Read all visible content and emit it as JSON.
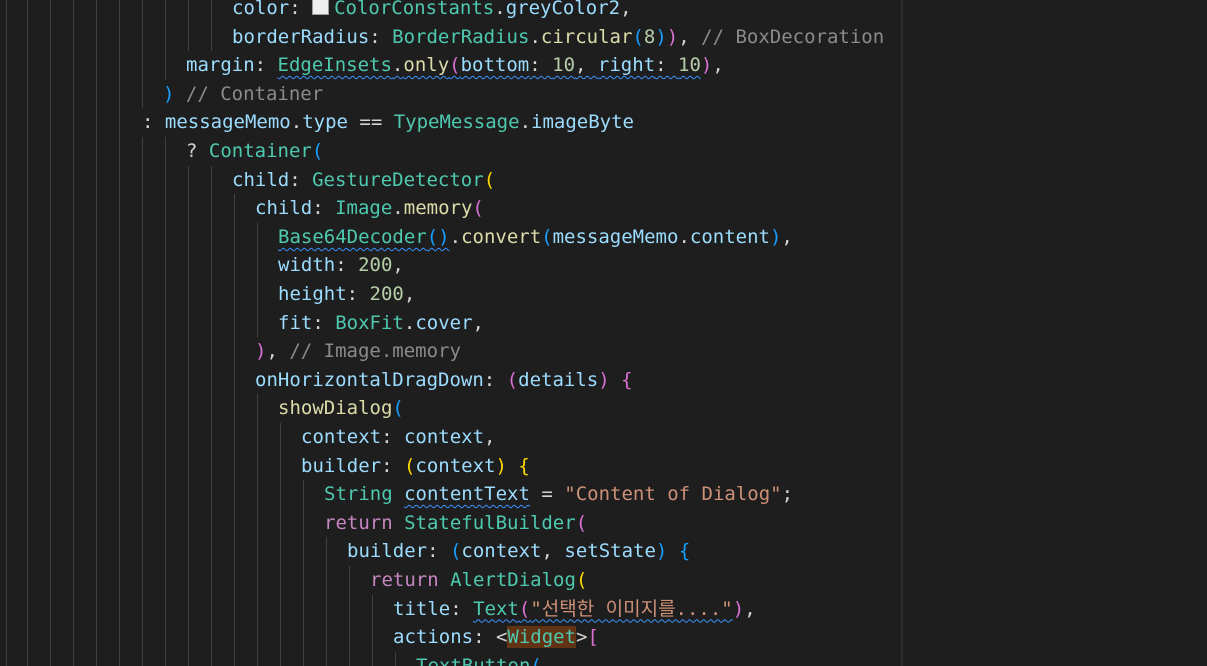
{
  "editor": {
    "language": "dart",
    "colors": {
      "background": "#1e1e1e",
      "default": "#d4d4d4",
      "property": "#9cdcfe",
      "type": "#4ec9b0",
      "method": "#dcdcaa",
      "number": "#b5cea8",
      "string": "#ce9178",
      "comment": "#6a9955",
      "commentGrey": "#8b8b8b",
      "keyword": "#c586c0",
      "bracket1": "#ffd700",
      "bracket2": "#da70d6",
      "bracket3": "#179fff"
    },
    "lines": [
      {
        "indent": 232,
        "guides": [
          6,
          27,
          50,
          73,
          96,
          119,
          142,
          165,
          188,
          211
        ],
        "tokens": [
          {
            "t": "color",
            "c": "property"
          },
          {
            "t": ": ",
            "c": "default"
          },
          {
            "t": "",
            "c": "swatch"
          },
          {
            "t": "ColorConstants",
            "c": "type"
          },
          {
            "t": ".",
            "c": "default"
          },
          {
            "t": "greyColor2",
            "c": "property"
          },
          {
            "t": ",",
            "c": "default"
          }
        ]
      },
      {
        "indent": 232,
        "guides": [
          6,
          27,
          50,
          73,
          96,
          119,
          142,
          165,
          188,
          211
        ],
        "tokens": [
          {
            "t": "borderRadius",
            "c": "property"
          },
          {
            "t": ": ",
            "c": "default"
          },
          {
            "t": "BorderRadius",
            "c": "type"
          },
          {
            "t": ".",
            "c": "default"
          },
          {
            "t": "circular",
            "c": "method"
          },
          {
            "t": "(",
            "c": "bracket3"
          },
          {
            "t": "8",
            "c": "number"
          },
          {
            "t": ")",
            "c": "bracket3"
          },
          {
            "t": ")",
            "c": "bracket2"
          },
          {
            "t": ", ",
            "c": "default"
          },
          {
            "t": "// BoxDecoration",
            "c": "commentGrey"
          }
        ]
      },
      {
        "indent": 186,
        "guides": [
          6,
          27,
          50,
          73,
          96,
          119,
          142,
          165
        ],
        "tokens": [
          {
            "t": "margin",
            "c": "property"
          },
          {
            "t": ": ",
            "c": "default"
          },
          {
            "t": "EdgeInsets",
            "c": "type",
            "sq": true
          },
          {
            "t": ".",
            "c": "default",
            "sq": true
          },
          {
            "t": "only",
            "c": "method",
            "sq": true
          },
          {
            "t": "(",
            "c": "bracket2",
            "sq": true
          },
          {
            "t": "bottom",
            "c": "property",
            "sq": true
          },
          {
            "t": ": ",
            "c": "default",
            "sq": true
          },
          {
            "t": "10",
            "c": "number",
            "sq": true
          },
          {
            "t": ", ",
            "c": "default",
            "sq": true
          },
          {
            "t": "right",
            "c": "property",
            "sq": true
          },
          {
            "t": ": ",
            "c": "default",
            "sq": true
          },
          {
            "t": "10",
            "c": "number",
            "sq": true
          },
          {
            "t": ")",
            "c": "bracket2"
          },
          {
            "t": ",",
            "c": "default"
          }
        ]
      },
      {
        "indent": 163,
        "guides": [
          6,
          27,
          50,
          73,
          96,
          119,
          142
        ],
        "tokens": [
          {
            "t": ")",
            "c": "bracket3"
          },
          {
            "t": " ",
            "c": "default"
          },
          {
            "t": "// Container",
            "c": "commentGrey"
          }
        ]
      },
      {
        "indent": 142,
        "guides": [
          6,
          27,
          50,
          73,
          96,
          119
        ],
        "tokens": [
          {
            "t": ": ",
            "c": "default"
          },
          {
            "t": "messageMemo",
            "c": "property"
          },
          {
            "t": ".",
            "c": "default"
          },
          {
            "t": "type",
            "c": "property"
          },
          {
            "t": " == ",
            "c": "default"
          },
          {
            "t": "TypeMessage",
            "c": "type"
          },
          {
            "t": ".",
            "c": "default"
          },
          {
            "t": "imageByte",
            "c": "property"
          }
        ]
      },
      {
        "indent": 186,
        "guides": [
          6,
          27,
          50,
          73,
          96,
          119,
          142,
          165
        ],
        "tokens": [
          {
            "t": "? ",
            "c": "default"
          },
          {
            "t": "Container",
            "c": "type"
          },
          {
            "t": "(",
            "c": "bracket3"
          }
        ]
      },
      {
        "indent": 232,
        "guides": [
          6,
          27,
          50,
          73,
          96,
          119,
          142,
          165,
          188,
          211
        ],
        "tokens": [
          {
            "t": "child",
            "c": "property"
          },
          {
            "t": ": ",
            "c": "default"
          },
          {
            "t": "GestureDetector",
            "c": "type"
          },
          {
            "t": "(",
            "c": "bracket1"
          }
        ]
      },
      {
        "indent": 255,
        "guides": [
          6,
          27,
          50,
          73,
          96,
          119,
          142,
          165,
          188,
          211,
          234
        ],
        "tokens": [
          {
            "t": "child",
            "c": "property"
          },
          {
            "t": ": ",
            "c": "default"
          },
          {
            "t": "Image",
            "c": "type"
          },
          {
            "t": ".",
            "c": "default"
          },
          {
            "t": "memory",
            "c": "method"
          },
          {
            "t": "(",
            "c": "bracket2"
          }
        ]
      },
      {
        "indent": 278,
        "guides": [
          6,
          27,
          50,
          73,
          96,
          119,
          142,
          165,
          188,
          211,
          234,
          257
        ],
        "tokens": [
          {
            "t": "Base64Decoder",
            "c": "type",
            "sq": true
          },
          {
            "t": "()",
            "c": "bracket3",
            "sq": true
          },
          {
            "t": ".",
            "c": "default"
          },
          {
            "t": "convert",
            "c": "method"
          },
          {
            "t": "(",
            "c": "bracket3"
          },
          {
            "t": "messageMemo",
            "c": "property"
          },
          {
            "t": ".",
            "c": "default"
          },
          {
            "t": "content",
            "c": "property"
          },
          {
            "t": ")",
            "c": "bracket3"
          },
          {
            "t": ",",
            "c": "default"
          }
        ]
      },
      {
        "indent": 278,
        "guides": [
          6,
          27,
          50,
          73,
          96,
          119,
          142,
          165,
          188,
          211,
          234,
          257
        ],
        "tokens": [
          {
            "t": "width",
            "c": "property"
          },
          {
            "t": ": ",
            "c": "default"
          },
          {
            "t": "200",
            "c": "number"
          },
          {
            "t": ",",
            "c": "default"
          }
        ]
      },
      {
        "indent": 278,
        "guides": [
          6,
          27,
          50,
          73,
          96,
          119,
          142,
          165,
          188,
          211,
          234,
          257
        ],
        "tokens": [
          {
            "t": "height",
            "c": "property"
          },
          {
            "t": ": ",
            "c": "default"
          },
          {
            "t": "200",
            "c": "number"
          },
          {
            "t": ",",
            "c": "default"
          }
        ]
      },
      {
        "indent": 278,
        "guides": [
          6,
          27,
          50,
          73,
          96,
          119,
          142,
          165,
          188,
          211,
          234,
          257
        ],
        "tokens": [
          {
            "t": "fit",
            "c": "property"
          },
          {
            "t": ": ",
            "c": "default"
          },
          {
            "t": "BoxFit",
            "c": "type"
          },
          {
            "t": ".",
            "c": "default"
          },
          {
            "t": "cover",
            "c": "property"
          },
          {
            "t": ",",
            "c": "default"
          }
        ]
      },
      {
        "indent": 255,
        "guides": [
          6,
          27,
          50,
          73,
          96,
          119,
          142,
          165,
          188,
          211,
          234
        ],
        "tokens": [
          {
            "t": ")",
            "c": "bracket2"
          },
          {
            "t": ", ",
            "c": "default"
          },
          {
            "t": "// Image.memory",
            "c": "commentGrey"
          }
        ]
      },
      {
        "indent": 255,
        "guides": [
          6,
          27,
          50,
          73,
          96,
          119,
          142,
          165,
          188,
          211,
          234
        ],
        "tokens": [
          {
            "t": "onHorizontalDragDown",
            "c": "property"
          },
          {
            "t": ": ",
            "c": "default"
          },
          {
            "t": "(",
            "c": "bracket2"
          },
          {
            "t": "details",
            "c": "property"
          },
          {
            "t": ")",
            "c": "bracket2"
          },
          {
            "t": " ",
            "c": "default"
          },
          {
            "t": "{",
            "c": "bracket2"
          }
        ]
      },
      {
        "indent": 278,
        "guides": [
          6,
          27,
          50,
          73,
          96,
          119,
          142,
          165,
          188,
          211,
          234,
          257
        ],
        "tokens": [
          {
            "t": "showDialog",
            "c": "method"
          },
          {
            "t": "(",
            "c": "bracket3"
          }
        ]
      },
      {
        "indent": 301,
        "guides": [
          6,
          27,
          50,
          73,
          96,
          119,
          142,
          165,
          188,
          211,
          234,
          257,
          280
        ],
        "tokens": [
          {
            "t": "context",
            "c": "property"
          },
          {
            "t": ": ",
            "c": "default"
          },
          {
            "t": "context",
            "c": "property"
          },
          {
            "t": ",",
            "c": "default"
          }
        ]
      },
      {
        "indent": 301,
        "guides": [
          6,
          27,
          50,
          73,
          96,
          119,
          142,
          165,
          188,
          211,
          234,
          257,
          280
        ],
        "tokens": [
          {
            "t": "builder",
            "c": "property"
          },
          {
            "t": ": ",
            "c": "default"
          },
          {
            "t": "(",
            "c": "bracket1"
          },
          {
            "t": "context",
            "c": "property"
          },
          {
            "t": ")",
            "c": "bracket1"
          },
          {
            "t": " ",
            "c": "default"
          },
          {
            "t": "{",
            "c": "bracket1"
          }
        ]
      },
      {
        "indent": 324,
        "guides": [
          6,
          27,
          50,
          73,
          96,
          119,
          142,
          165,
          188,
          211,
          234,
          257,
          280,
          303
        ],
        "tokens": [
          {
            "t": "String",
            "c": "type"
          },
          {
            "t": " ",
            "c": "default"
          },
          {
            "t": "contentText",
            "c": "property",
            "sq": true
          },
          {
            "t": " = ",
            "c": "default"
          },
          {
            "t": "\"Content of Dialog\"",
            "c": "string"
          },
          {
            "t": ";",
            "c": "default"
          }
        ]
      },
      {
        "indent": 324,
        "guides": [
          6,
          27,
          50,
          73,
          96,
          119,
          142,
          165,
          188,
          211,
          234,
          257,
          280,
          303
        ],
        "tokens": [
          {
            "t": "return",
            "c": "keyword"
          },
          {
            "t": " ",
            "c": "default"
          },
          {
            "t": "StatefulBuilder",
            "c": "type"
          },
          {
            "t": "(",
            "c": "bracket2"
          }
        ]
      },
      {
        "indent": 347,
        "guides": [
          6,
          27,
          50,
          73,
          96,
          119,
          142,
          165,
          188,
          211,
          234,
          257,
          280,
          303,
          326
        ],
        "tokens": [
          {
            "t": "builder",
            "c": "property"
          },
          {
            "t": ": ",
            "c": "default"
          },
          {
            "t": "(",
            "c": "bracket3"
          },
          {
            "t": "context",
            "c": "property"
          },
          {
            "t": ", ",
            "c": "default"
          },
          {
            "t": "setState",
            "c": "property"
          },
          {
            "t": ")",
            "c": "bracket3"
          },
          {
            "t": " ",
            "c": "default"
          },
          {
            "t": "{",
            "c": "bracket3"
          }
        ]
      },
      {
        "indent": 370,
        "guides": [
          6,
          27,
          50,
          73,
          96,
          119,
          142,
          165,
          188,
          211,
          234,
          257,
          280,
          303,
          326,
          349
        ],
        "tokens": [
          {
            "t": "return",
            "c": "keyword"
          },
          {
            "t": " ",
            "c": "default"
          },
          {
            "t": "AlertDialog",
            "c": "type"
          },
          {
            "t": "(",
            "c": "bracket1"
          }
        ]
      },
      {
        "indent": 393,
        "guides": [
          6,
          27,
          50,
          73,
          96,
          119,
          142,
          165,
          188,
          211,
          234,
          257,
          280,
          303,
          326,
          349,
          372
        ],
        "tokens": [
          {
            "t": "title",
            "c": "property"
          },
          {
            "t": ": ",
            "c": "default"
          },
          {
            "t": "Text",
            "c": "type",
            "sq": true
          },
          {
            "t": "(",
            "c": "bracket2",
            "sq": true
          },
          {
            "t": "\"선택한 이미지를....\"",
            "c": "string",
            "sq": true
          },
          {
            "t": ")",
            "c": "bracket2"
          },
          {
            "t": ",",
            "c": "default"
          }
        ]
      },
      {
        "indent": 393,
        "guides": [
          6,
          27,
          50,
          73,
          96,
          119,
          142,
          165,
          188,
          211,
          234,
          257,
          280,
          303,
          326,
          349,
          372
        ],
        "tokens": [
          {
            "t": "actions",
            "c": "property"
          },
          {
            "t": ": <",
            "c": "default"
          },
          {
            "t": "Widget",
            "c": "type",
            "hl": true
          },
          {
            "t": ">",
            "c": "default"
          },
          {
            "t": "[",
            "c": "bracket2"
          }
        ]
      },
      {
        "indent": 416,
        "guides": [
          6,
          27,
          50,
          73,
          96,
          119,
          142,
          165,
          188,
          211,
          234,
          257,
          280,
          303,
          326,
          349,
          372,
          395
        ],
        "tokens": [
          {
            "t": "TextButton",
            "c": "type"
          },
          {
            "t": "(",
            "c": "bracket3"
          }
        ]
      }
    ]
  }
}
